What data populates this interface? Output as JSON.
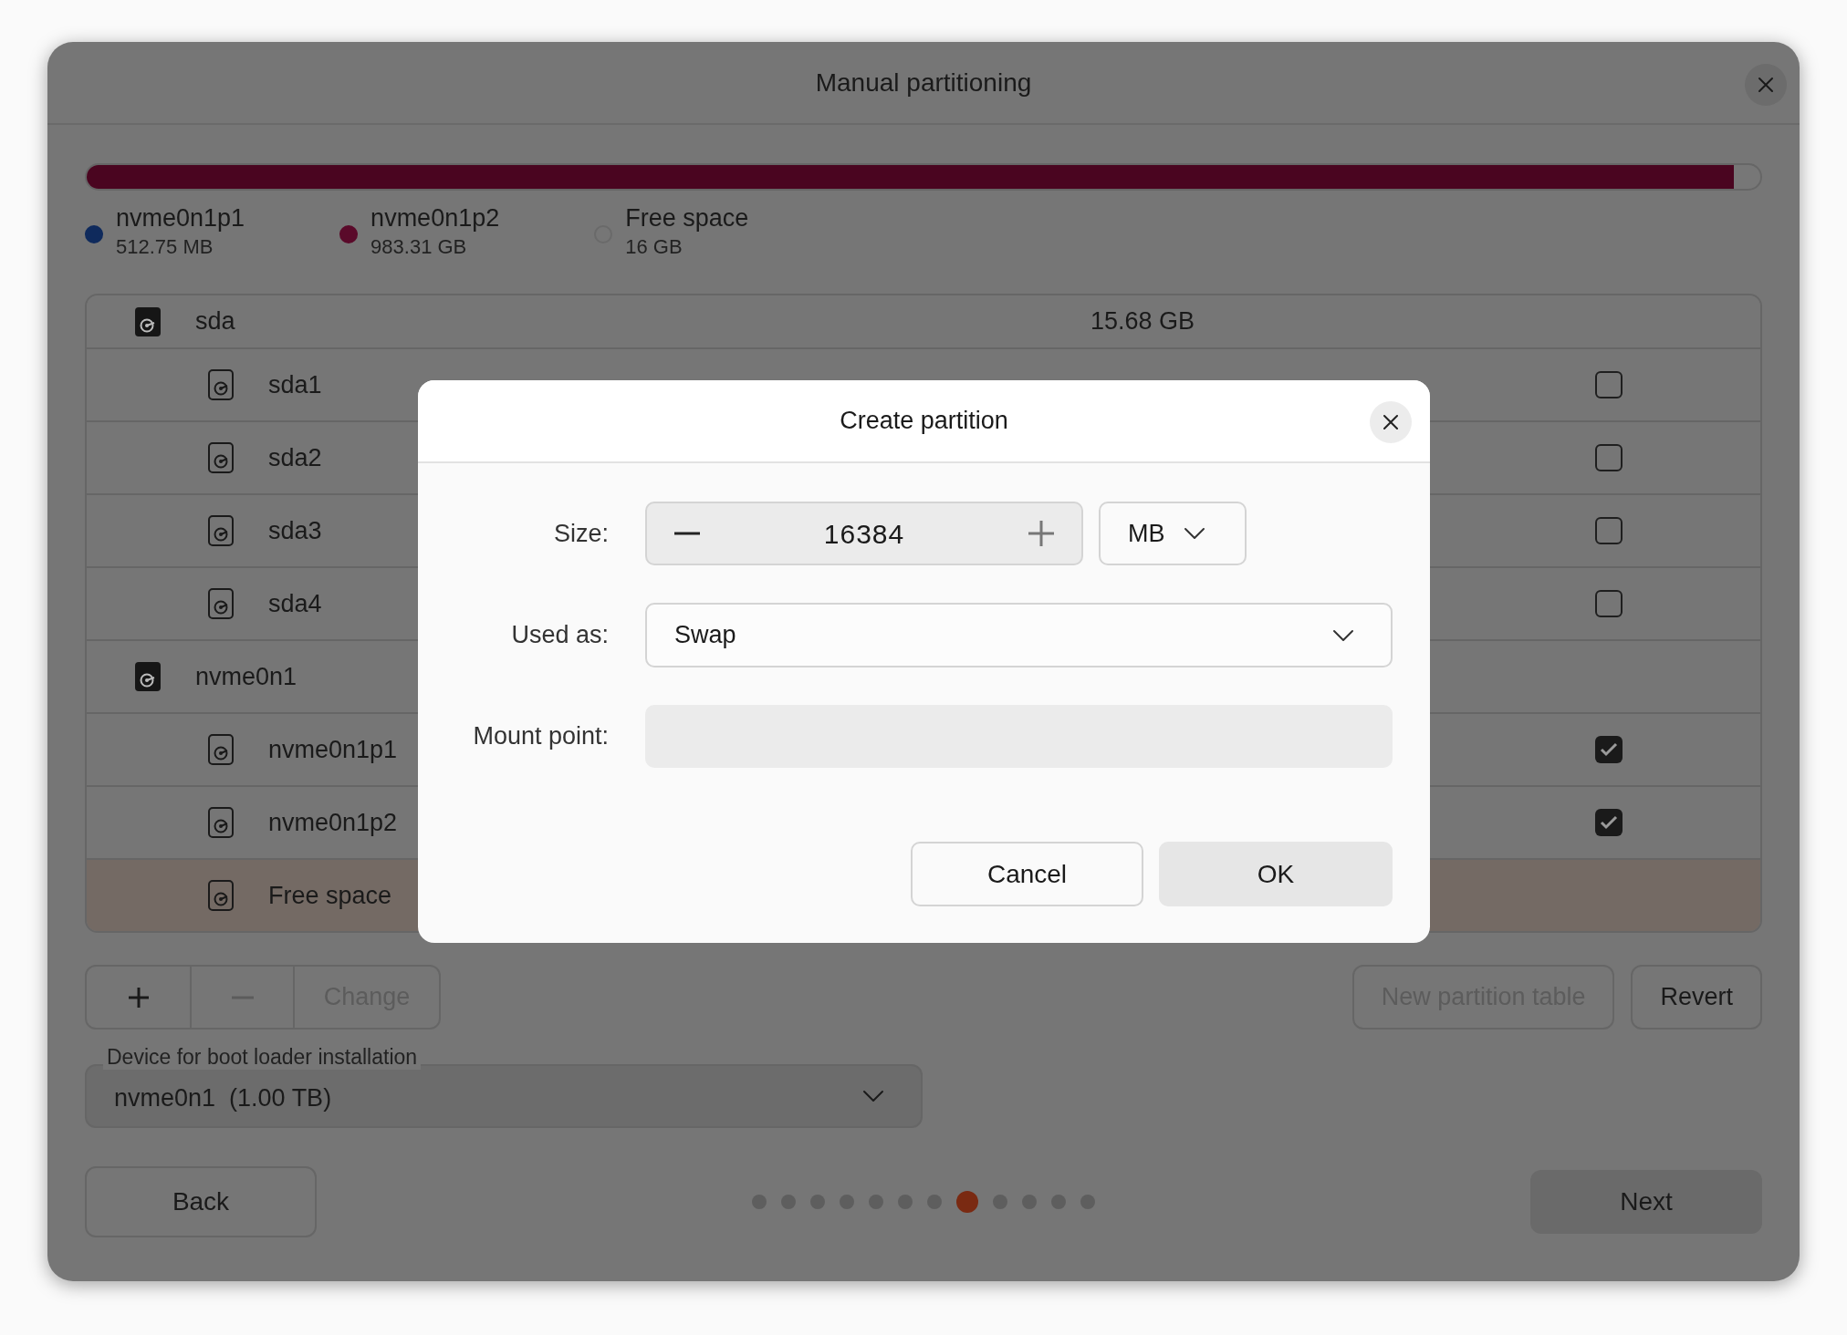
{
  "window": {
    "title": "Manual partitioning"
  },
  "usage_bar": {
    "level": 0.984
  },
  "legend": [
    {
      "name": "nvme0n1p1",
      "size": "512.75 MB",
      "kind": "filled",
      "color": "#0f2a5c"
    },
    {
      "name": "nvme0n1p2",
      "size": "983.31 GB",
      "kind": "filled",
      "color": "#5a0a2a"
    },
    {
      "name": "Free space",
      "size": "16 GB",
      "kind": "empty"
    }
  ],
  "devices": [
    {
      "name": "sda",
      "size": "15.68 GB",
      "selected": false,
      "children": [
        {
          "name": "sda1",
          "checked": false,
          "selected": false
        },
        {
          "name": "sda2",
          "checked": false,
          "selected": false
        },
        {
          "name": "sda3",
          "checked": false,
          "selected": false
        },
        {
          "name": "sda4",
          "checked": false,
          "selected": false
        }
      ]
    },
    {
      "name": "nvme0n1",
      "selected": false,
      "children": [
        {
          "name": "nvme0n1p1",
          "checked": true,
          "selected": false
        },
        {
          "name": "nvme0n1p2",
          "checked": true,
          "selected": false
        },
        {
          "name": "Free space",
          "selected": true
        }
      ]
    }
  ],
  "toolbar": [
    {
      "kind": "add",
      "disabled": false
    },
    {
      "kind": "remove",
      "disabled": true
    },
    {
      "kind": "text",
      "label": "Change",
      "disabled": true
    }
  ],
  "table_buttons": [
    {
      "label": "New partition table",
      "disabled": true
    },
    {
      "label": "Revert",
      "disabled": false
    }
  ],
  "boot_loader": {
    "label": "Device for boot loader installation",
    "value": "nvme0n1  (1.00 TB)"
  },
  "back_button": "Back",
  "next_button": "Next",
  "pager": [
    {
      "selected": false
    },
    {
      "selected": false
    },
    {
      "selected": false
    },
    {
      "selected": false
    },
    {
      "selected": false
    },
    {
      "selected": false
    },
    {
      "selected": false
    },
    {
      "selected": true
    },
    {
      "selected": false
    },
    {
      "selected": false
    },
    {
      "selected": false
    },
    {
      "selected": false
    }
  ],
  "dialog": {
    "title": "Create partition",
    "size_label": "Size:",
    "size_value": "16384",
    "size_unit": "MB",
    "used_as_label": "Used as:",
    "used_as_value": "Swap",
    "mount_label": "Mount point:",
    "cancel": "Cancel",
    "ok": "OK"
  }
}
